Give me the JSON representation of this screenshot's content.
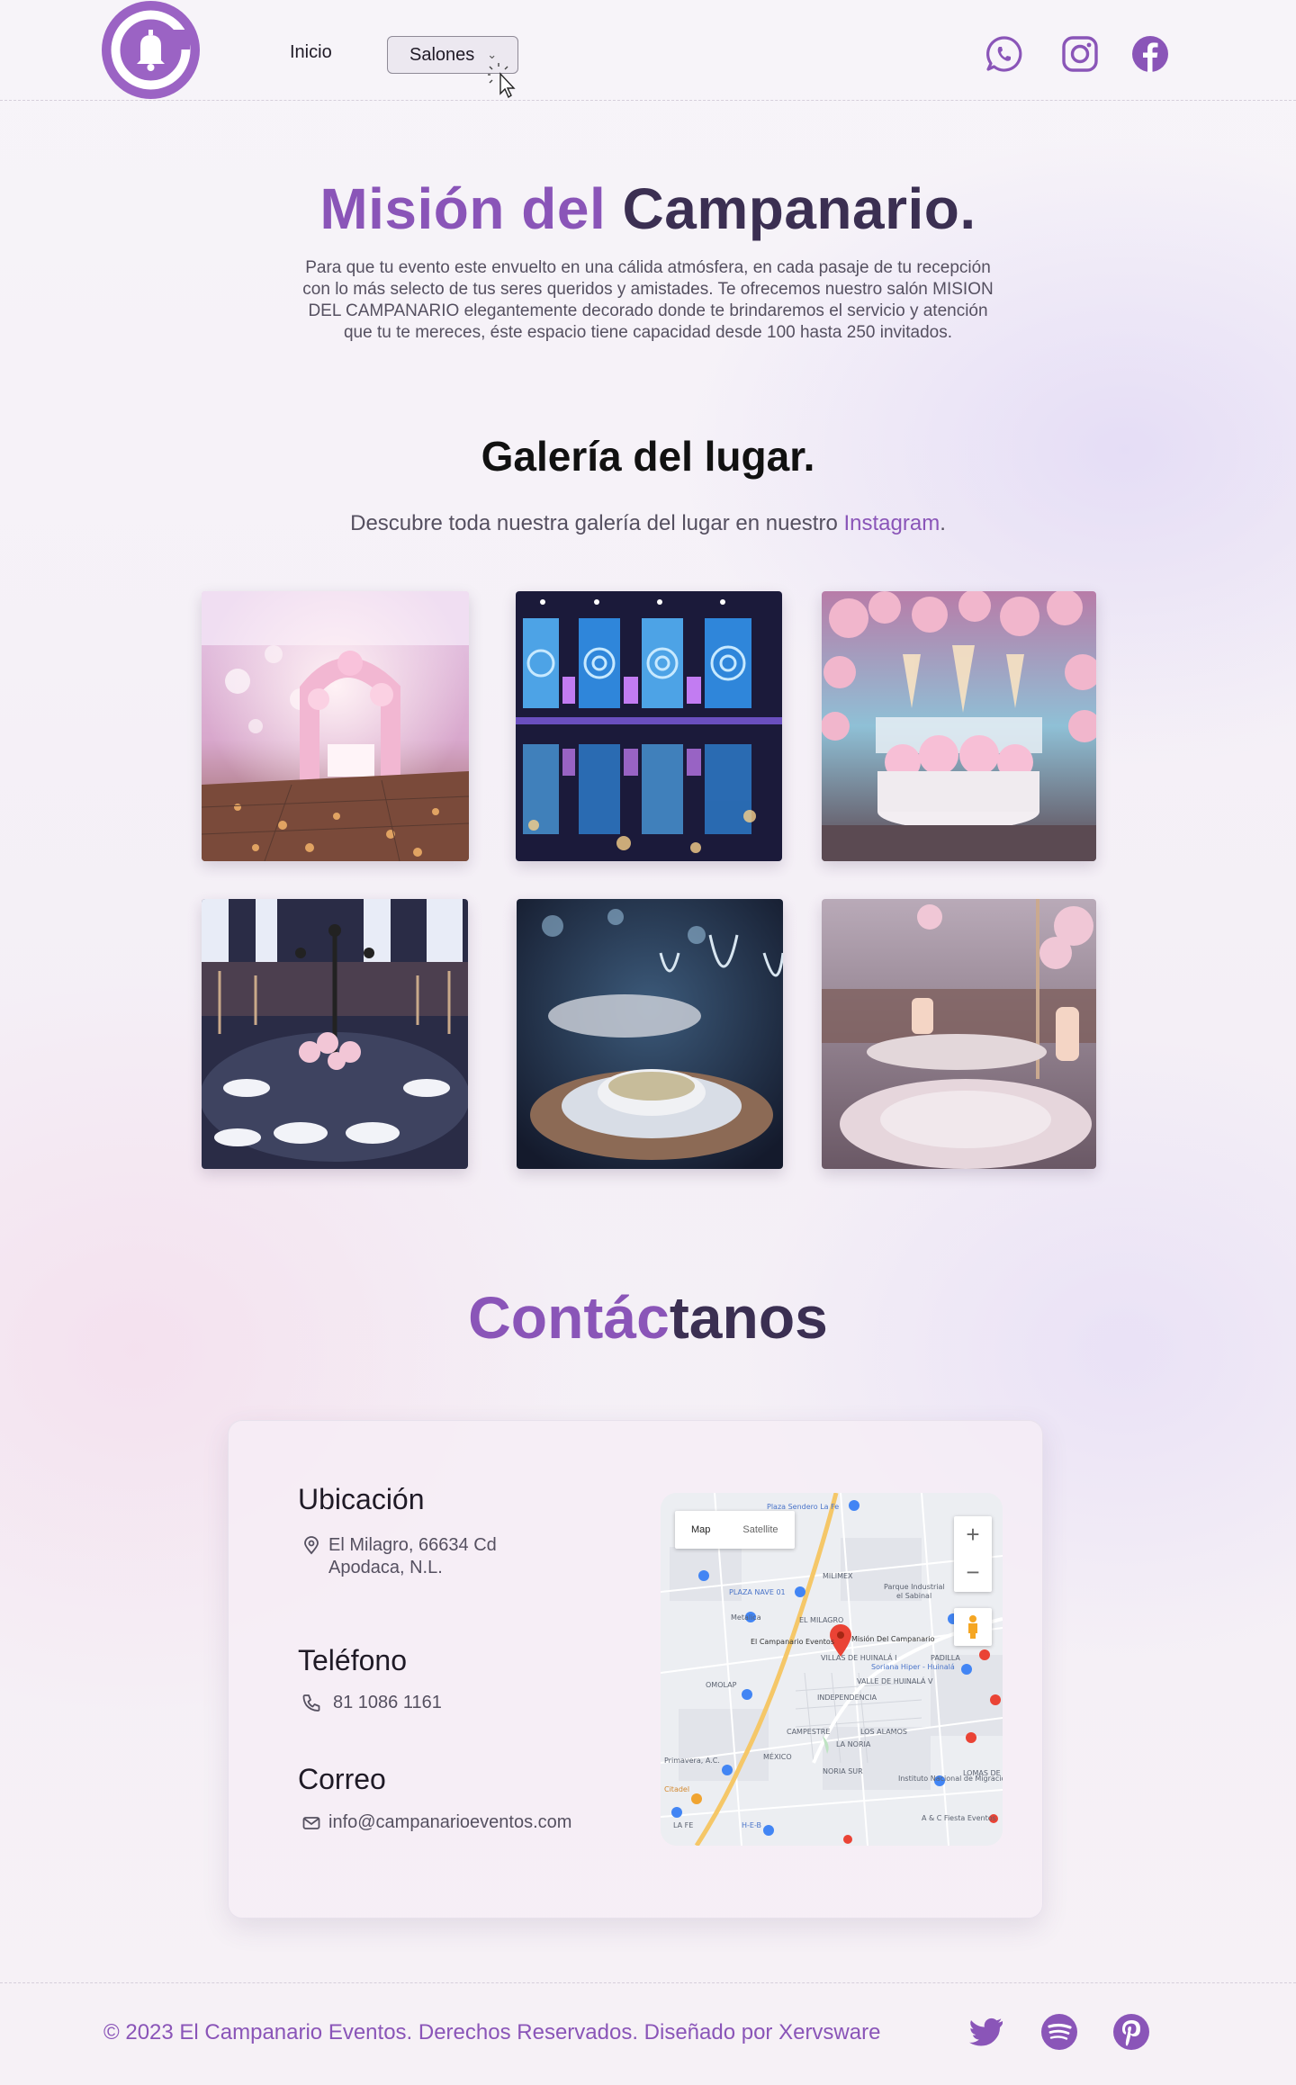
{
  "brand": {
    "logo": "bell-c-logo",
    "accent_color": "#8a55b8",
    "accent_light": "#9b63c4"
  },
  "nav": {
    "items": [
      {
        "label": "Inicio"
      },
      {
        "label": "Salones",
        "has_dropdown": true
      }
    ]
  },
  "social_top": [
    {
      "icon": "whatsapp-icon"
    },
    {
      "icon": "instagram-icon"
    },
    {
      "icon": "facebook-icon"
    }
  ],
  "hero": {
    "title_accent": "Misión del",
    "title_rest": "Campanario.",
    "description": "Para que tu evento este envuelto en una cálida atmósfera, en cada pasaje de tu recepción con lo más selecto de tus seres queridos y amistades. Te ofrecemos nuestro salón MISION DEL CAMPANARIO elegantemente decorado donde te brindaremos el servicio y atención que tu te mereces, éste espacio tiene capacidad desde 100 hasta 250 invitados."
  },
  "gallery": {
    "title": "Galería del lugar.",
    "desc_prefix": "Descubre toda nuestra galería del lugar en nuestro",
    "desc_link": "Instagram",
    "desc_suffix": ".",
    "photos": [
      {
        "subject": "floral-arch-dance-floor"
      },
      {
        "subject": "led-wall-stage"
      },
      {
        "subject": "head-table-chandeliers"
      },
      {
        "subject": "round-table-centerpiece"
      },
      {
        "subject": "soup-place-setting"
      },
      {
        "subject": "table-with-drinks"
      }
    ]
  },
  "contact": {
    "title_accent": "Contác",
    "title_rest": "tanos",
    "location": {
      "title": "Ubicación",
      "line1": "El Milagro, 66634 Cd",
      "line2": "Apodaca, N.L."
    },
    "phone": {
      "title": "Teléfono",
      "value": "81 1086 1161"
    },
    "email": {
      "title": "Correo",
      "value": "info@campanarioeventos.com"
    },
    "map": {
      "tab_map": "Map",
      "tab_satellite": "Satellite",
      "zoom_in": "+",
      "zoom_out": "−",
      "labels": {
        "plaza_sendero": "Plaza Sendero La Fe",
        "plaza_nave": "PLAZA NAVE 01",
        "milimex": "MILIMEX",
        "parque": "Parque Industrial",
        "sabinal": "el Sabinal",
        "metalica": "Metalica",
        "el_milagro": "EL MILAGRO",
        "campanario": "El Campanario Eventos",
        "mision": "Misión Del Campanario",
        "villas": "VILLAS DE HUINALÁ I",
        "padilla": "PADILLA",
        "omolap": "OMOLAP",
        "valle": "VALLE DE HUINALÁ V",
        "soriana": "Soriana Hiper - Huinalá",
        "independencia": "INDEPENDENCIA",
        "campestre": "CAMPESTRE",
        "los_alamos": "LOS ALAMOS",
        "la_noria": "LA NORIA",
        "mexico": "MÉXICO",
        "noria_sur": "NORIA SUR",
        "instituto": "Instituto Nacional de Migración",
        "citadel": "Citadel",
        "lomas": "LOMAS DE HUINALÁ",
        "la_fe": "LA FE",
        "heb": "H-E-B",
        "fiesta": "A & C Fiesta Eventos",
        "primavera": "Primavera, A.C."
      }
    }
  },
  "footer": {
    "text": "© 2023 El Campanario Eventos. Derechos Reservados. Diseñado por Xervsware",
    "social": [
      {
        "icon": "twitter-icon"
      },
      {
        "icon": "spotify-icon"
      },
      {
        "icon": "pinterest-icon"
      }
    ]
  }
}
